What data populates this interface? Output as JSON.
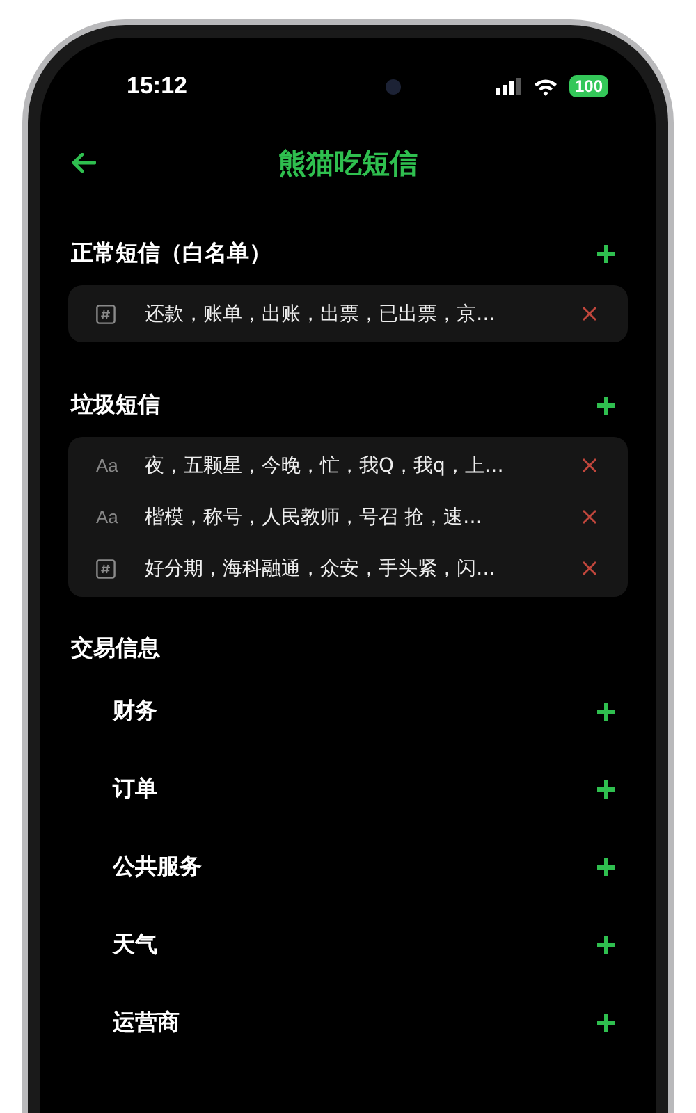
{
  "status_bar": {
    "time": "15:12",
    "battery": "100"
  },
  "header": {
    "title": "熊猫吃短信"
  },
  "sections": [
    {
      "title": "正常短信（白名单）",
      "rules": [
        {
          "kind": "pattern",
          "text": "还款，账单，出账，出票，已出票，京…"
        }
      ]
    },
    {
      "title": "垃圾短信",
      "rules": [
        {
          "kind": "keyword",
          "marker": "Aa",
          "text": "夜，五颗星，今晚，忙，我Q，我q，上…"
        },
        {
          "kind": "keyword",
          "marker": "Aa",
          "text": "楷模，称号，人民教师，号召 抢，速…"
        },
        {
          "kind": "pattern",
          "text": "好分期，海科融通，众安，手头紧，闪…"
        }
      ]
    }
  ],
  "trade": {
    "title": "交易信息",
    "items": [
      "财务",
      "订单",
      "公共服务",
      "天气",
      "运营商"
    ]
  }
}
